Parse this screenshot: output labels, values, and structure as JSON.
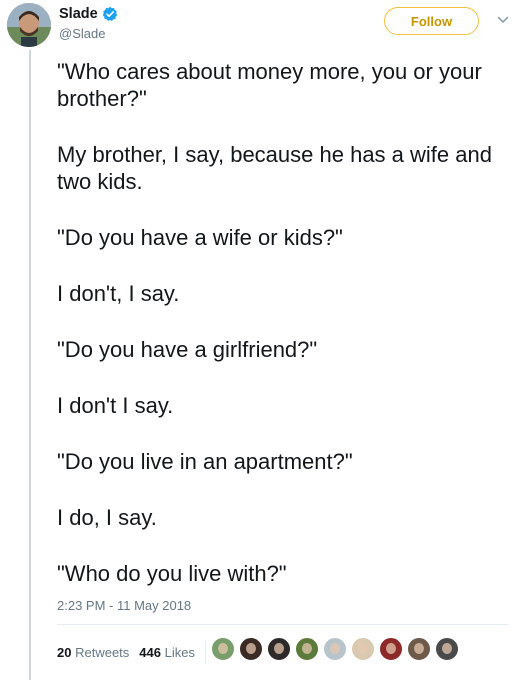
{
  "user": {
    "display_name": "Slade",
    "handle": "@Slade",
    "verified_icon": "verified-badge-icon"
  },
  "actions": {
    "follow_label": "Follow",
    "menu_icon": "chevron-down-icon"
  },
  "tweet": {
    "paragraphs": [
      "\"Who cares about money more, you or your brother?\"",
      "My brother, I say, because he has a wife and two kids.",
      "\"Do you have a wife or kids?\"",
      "I don't, I say.",
      "\"Do you have a girlfriend?\"",
      "I don't I say.",
      "\"Do you live in an apartment?\"",
      "I do, I say.",
      "\"Who do you live with?\""
    ],
    "timestamp": "2:23 PM - 11 May 2018"
  },
  "stats": {
    "retweets_count": "20",
    "retweets_label": "Retweets",
    "likes_count": "446",
    "likes_label": "Likes"
  },
  "likers": [
    {
      "color": "#7a9e6b"
    },
    {
      "color": "#3b2b24"
    },
    {
      "color": "#2f2a2a"
    },
    {
      "color": "#5c7a3a"
    },
    {
      "color": "#b8c4cc"
    },
    {
      "color": "#d9c9b0"
    },
    {
      "color": "#8c2a2a"
    },
    {
      "color": "#6e5a4a"
    },
    {
      "color": "#4a4a4a"
    }
  ],
  "colors": {
    "accent_gold": "#f5c042",
    "follow_text": "#c79500",
    "verified_blue": "#1da1f2",
    "muted_text": "#657786"
  }
}
